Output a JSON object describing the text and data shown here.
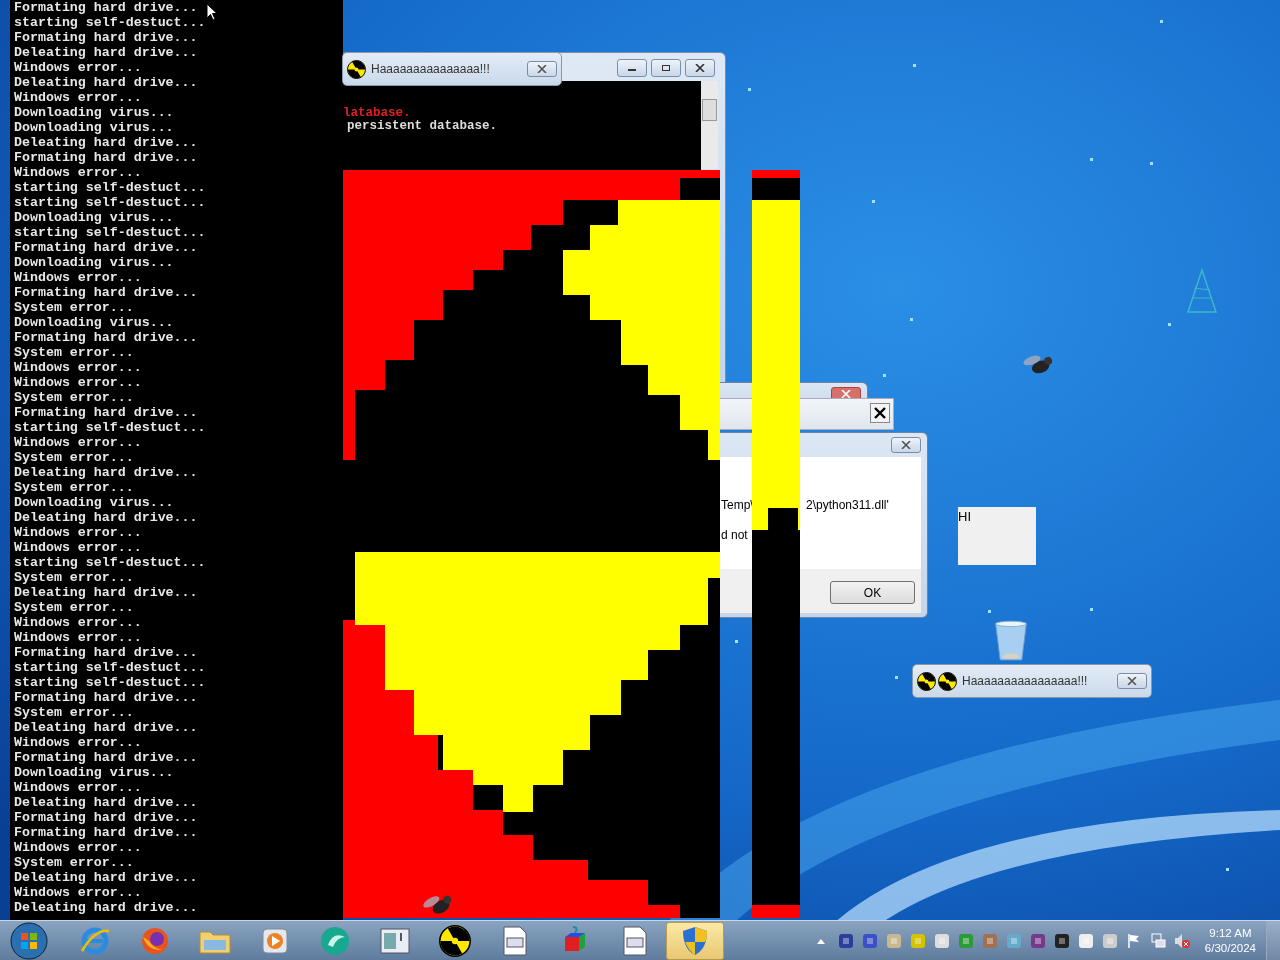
{
  "console": {
    "lines": [
      "Formating hard drive...",
      "starting self-destuct...",
      "Formating hard drive...",
      "Deleating hard drive...",
      "Windows error...",
      "Deleating hard drive...",
      "Windows error...",
      "Downloading virus...",
      "Downloading virus...",
      "Deleating hard drive...",
      "Formating hard drive...",
      "Windows error...",
      "starting self-destuct...",
      "starting self-destuct...",
      "Downloading virus...",
      "starting self-destuct...",
      "Formating hard drive...",
      "Downloading virus...",
      "Windows error...",
      "Formating hard drive...",
      "System error...",
      "Downloading virus...",
      "Formating hard drive...",
      "System error...",
      "Windows error...",
      "Windows error...",
      "System error...",
      "Formating hard drive...",
      "starting self-destuct...",
      "Windows error...",
      "System error...",
      "Deleating hard drive...",
      "System error...",
      "Downloading virus...",
      "Deleating hard drive...",
      "Windows error...",
      "Windows error...",
      "starting self-destuct...",
      "System error...",
      "Deleating hard drive...",
      "System error...",
      "Windows error...",
      "Windows error...",
      "Formating hard drive...",
      "starting self-destuct...",
      "starting self-destuct...",
      "Formating hard drive...",
      "System error...",
      "Deleating hard drive...",
      "Windows error...",
      "Formating hard drive...",
      "Downloading virus...",
      "Windows error...",
      "Deleating hard drive...",
      "Formating hard drive...",
      "Formating hard drive...",
      "Windows error...",
      "System error...",
      "Deleating hard drive...",
      "Windows error...",
      "Deleating hard drive..."
    ]
  },
  "background_console": {
    "lines": [
      {
        "text": "latabase.",
        "kind": "error"
      },
      {
        "text": "persistent database.",
        "kind": "normal"
      }
    ]
  },
  "message_boxes": [
    {
      "title": "Haaaaaaaaaaaaaaa!!!",
      "kind": "single"
    },
    {
      "title": "Haaaaaaaaaaaaaaaa!!!",
      "kind": "double"
    }
  ],
  "error_dialog": {
    "lines": [
      "Temp\\",
      "2\\python311.dll'",
      "d not"
    ],
    "button": "OK"
  },
  "hi_window": {
    "text": "HI"
  },
  "taskbar": {
    "apps": [
      {
        "kind": "ie",
        "selected": false
      },
      {
        "kind": "firefox",
        "selected": false
      },
      {
        "kind": "folder",
        "selected": false
      },
      {
        "kind": "media",
        "selected": false
      },
      {
        "kind": "teal",
        "selected": false
      },
      {
        "kind": "window",
        "selected": false
      },
      {
        "kind": "radiation",
        "selected": false
      },
      {
        "kind": "document",
        "selected": false
      },
      {
        "kind": "cube",
        "selected": false
      },
      {
        "kind": "document",
        "selected": false
      },
      {
        "kind": "shield",
        "selected": true
      }
    ],
    "time": "9:12 AM",
    "date": "6/30/2024"
  }
}
